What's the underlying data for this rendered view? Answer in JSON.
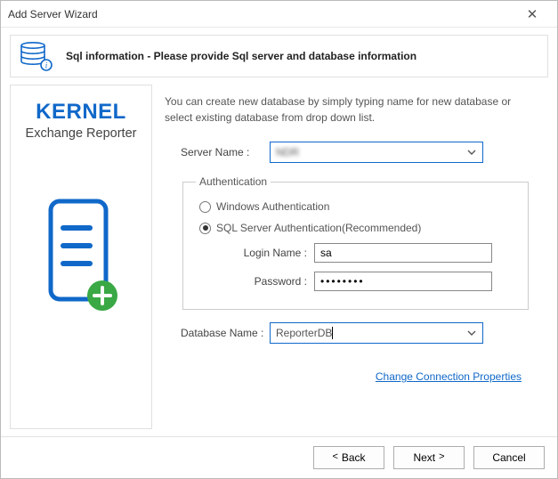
{
  "window": {
    "title": "Add Server Wizard"
  },
  "header": {
    "text": "Sql information - Please provide Sql server and database information"
  },
  "brand": {
    "name": "KERNEL",
    "product": "Exchange Reporter"
  },
  "intro": "You can create new database by simply typing name for new database or select existing database from drop down list.",
  "form": {
    "server_label": "Server Name :",
    "server_value": "NDR",
    "auth_legend": "Authentication",
    "radio_windows": "Windows Authentication",
    "radio_sql": "SQL Server Authentication(Recommended)",
    "login_label": "Login Name :",
    "login_value": "sa",
    "password_label": "Password :",
    "password_value": "••••••••",
    "database_label": "Database Name :",
    "database_value": "ReporterDB"
  },
  "link": {
    "change_props": "Change Connection Properties"
  },
  "buttons": {
    "back": "Back",
    "next": "Next",
    "cancel": "Cancel"
  }
}
